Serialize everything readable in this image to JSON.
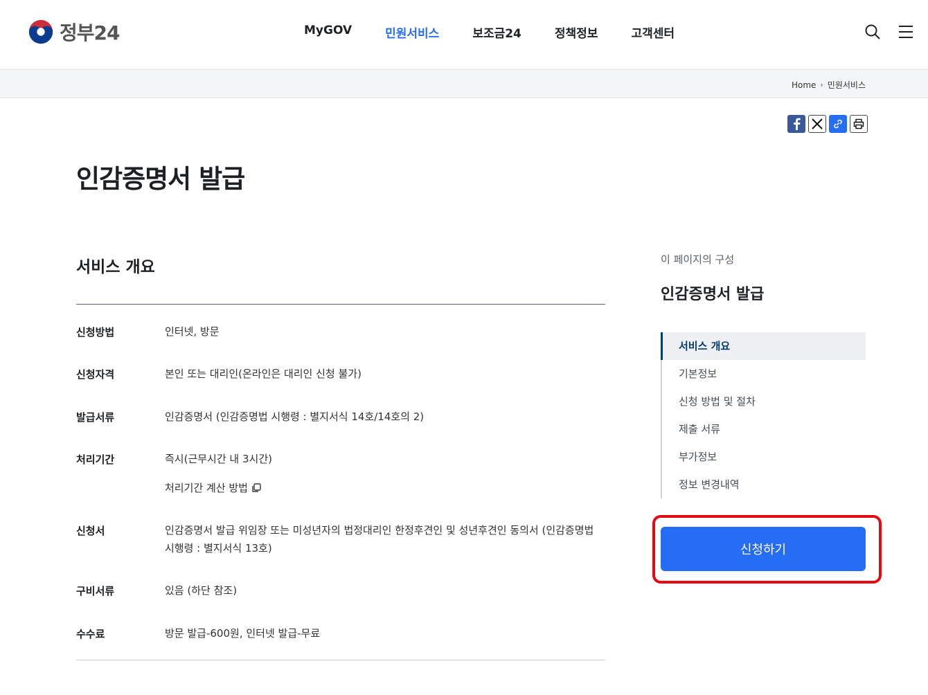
{
  "header": {
    "logo_text": "정부24",
    "nav": [
      {
        "label": "MyGOV",
        "active": false
      },
      {
        "label": "민원서비스",
        "active": true
      },
      {
        "label": "보조금24",
        "active": false
      },
      {
        "label": "정책정보",
        "active": false
      },
      {
        "label": "고객센터",
        "active": false
      }
    ],
    "search_icon": "search-icon",
    "menu_icon": "hamburger-menu-icon"
  },
  "breadcrumb": {
    "home": "Home",
    "current": "민원서비스"
  },
  "share": [
    "facebook-icon",
    "x-icon",
    "link-icon",
    "print-icon"
  ],
  "page_title": "인감증명서 발급",
  "overview": {
    "title": "서비스 개요",
    "rows": [
      {
        "label": "신청방법",
        "value": "인터넷, 방문"
      },
      {
        "label": "신청자격",
        "value": "본인 또는 대리인(온라인은 대리인 신청 불가)"
      },
      {
        "label": "발급서류",
        "value": "인감증명서 (인감증명법 시행령 : 별지서식 14호/14호의 2)"
      },
      {
        "label": "처리기간",
        "value": "즉시(근무시간 내 3시간)",
        "link": "처리기간 계산 방법"
      },
      {
        "label": "신청서",
        "value": "인감증명서 발급 위임장 또는 미성년자의 법정대리인 한정후견인 및 성년후견인 동의서 (인감증명법 시행령 : 별지서식 13호)"
      },
      {
        "label": "구비서류",
        "value": "있음 (하단 참조)"
      },
      {
        "label": "수수료",
        "value": "방문 발급-600원, 인터넷 발급-무료"
      }
    ]
  },
  "toc": {
    "caption": "이 페이지의 구성",
    "title": "인감증명서 발급",
    "items": [
      {
        "label": "서비스 개요",
        "active": true
      },
      {
        "label": "기본정보",
        "active": false
      },
      {
        "label": "신청 방법 및 절차",
        "active": false
      },
      {
        "label": "제출 서류",
        "active": false
      },
      {
        "label": "부가정보",
        "active": false
      },
      {
        "label": "정보 변경내역",
        "active": false
      }
    ]
  },
  "apply_button": "신청하기",
  "colors": {
    "primary": "#256ef4",
    "toc_active": "#063a74",
    "highlight": "#e50914"
  }
}
